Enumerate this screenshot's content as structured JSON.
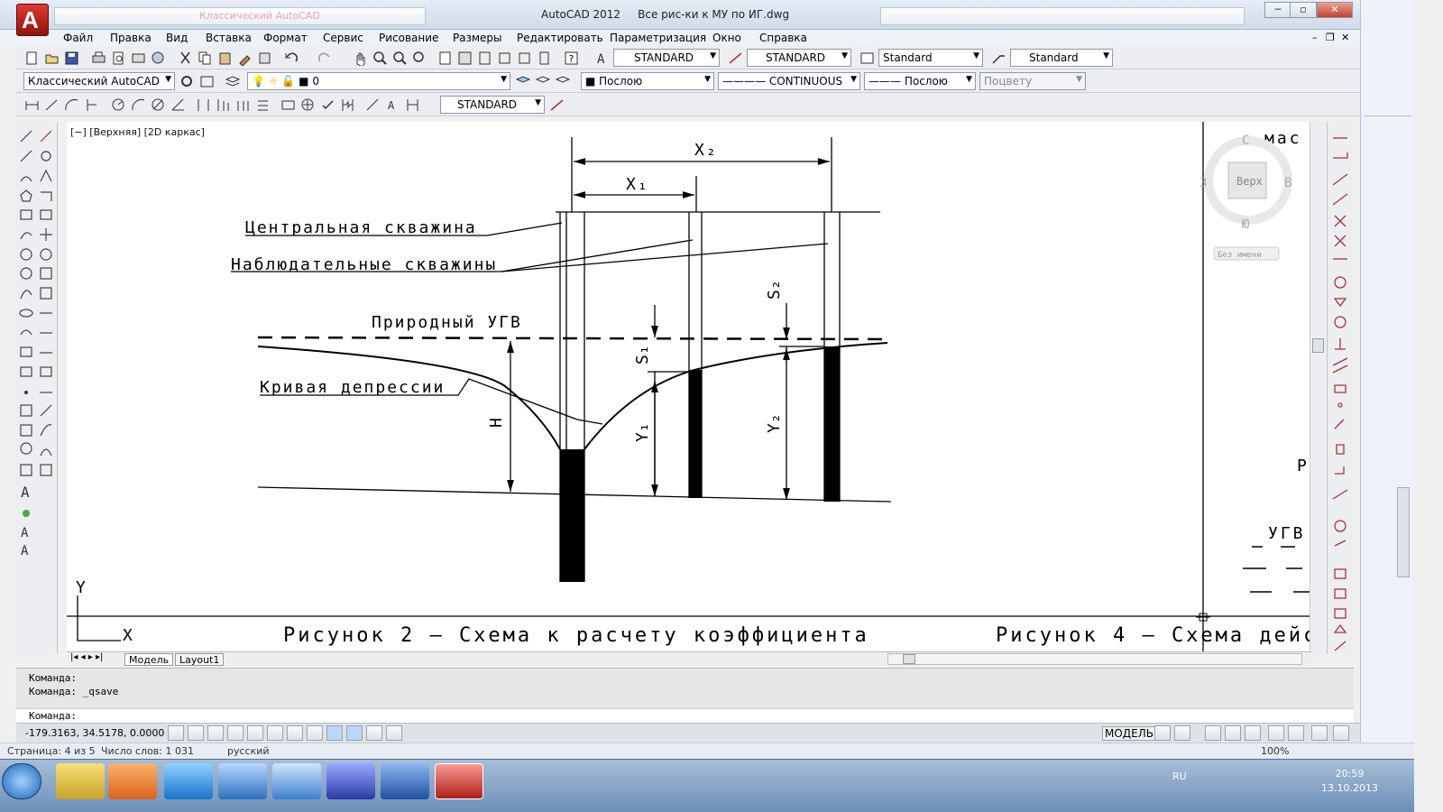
{
  "window": {
    "app_name": "AutoCAD 2012",
    "file_title": "Все рис-ки к МУ по ИГ.dwg",
    "background_app_title": "Классический AutoCAD"
  },
  "menu": [
    "Файл",
    "Правка",
    "Вид",
    "Вставка",
    "Формат",
    "Сервис",
    "Рисование",
    "Размеры",
    "Редактировать",
    "Параметризация",
    "Окно",
    "Справка"
  ],
  "toolbar1": {
    "text_style": "STANDARD",
    "dim_style": "STANDARD",
    "table_style": "Standard",
    "mleader_style": "Standard"
  },
  "toolbar2": {
    "workspace": "Классический AutoCAD",
    "layer": "0",
    "color": "Послою",
    "linetype": "CONTINUOUS",
    "lineweight": "Послою",
    "plotstyle": "Поцвету"
  },
  "toolbar3": {
    "dim_style": "STANDARD"
  },
  "viewport": {
    "label": "[−] [Верхняя] [2D каркас]",
    "viewcube": {
      "north": "С",
      "south": "Ю",
      "west": "З",
      "east": "В",
      "top": "Верх",
      "wcs": "Без имени"
    }
  },
  "drawing": {
    "x2": "X₂",
    "x1": "X₁",
    "central_well": "Центральная скважина",
    "observation_wells": "Наблюдательные скважины",
    "natural_gwl": "Природный УГВ",
    "depression_curve": "Кривая депрессии",
    "h": "H",
    "s1": "S₁",
    "s2": "S₂",
    "y1": "Y₁",
    "y2": "Y₂",
    "axis_y": "Y",
    "axis_x": "X",
    "caption2": "Рисунок 2 – Схема к расчету коэффициента",
    "caption4": "Рисунок 4 – Схема дейс",
    "right_mas": "мас",
    "right_r": "Р",
    "right_ugv": "УГВ"
  },
  "tabs": [
    "Модель",
    "Layout1"
  ],
  "command": {
    "line1": "Команда:",
    "line2": "Команда:  _qsave",
    "prompt": "Команда:"
  },
  "status": {
    "coords": "-179.3163, 34.5178, 0.0000",
    "model": "МОДЕЛЬ"
  },
  "word_status": {
    "page": "Страница: 4 из 5",
    "words": "Число слов: 1 031",
    "lang": "русский",
    "zoom": "100%"
  },
  "taskbar": {
    "lang": "RU",
    "time": "20:59",
    "date": "13.10.2013"
  }
}
